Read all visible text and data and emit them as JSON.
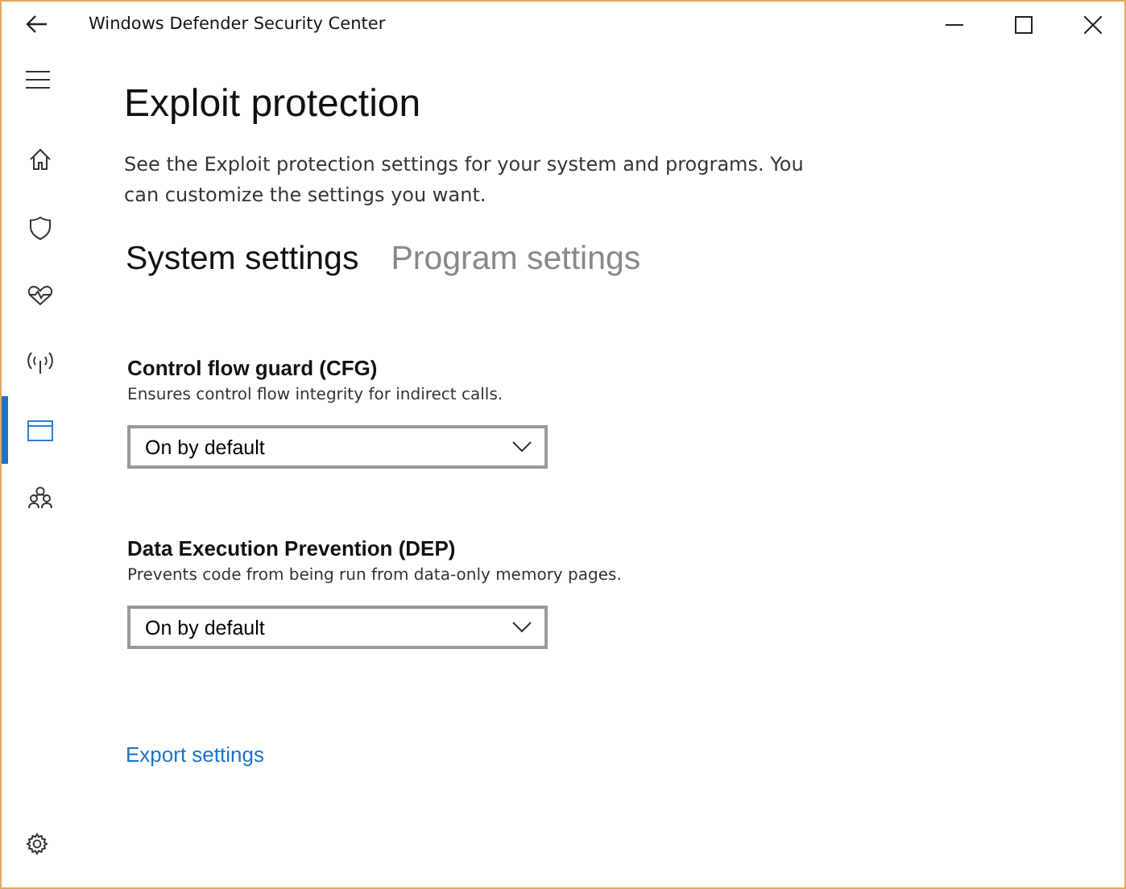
{
  "window": {
    "title": "Windows Defender Security Center"
  },
  "nav": [
    {
      "kind": "home",
      "selected": false
    },
    {
      "kind": "shield",
      "selected": false
    },
    {
      "kind": "heart",
      "selected": false
    },
    {
      "kind": "antenna",
      "selected": false
    },
    {
      "kind": "window",
      "selected": true
    },
    {
      "kind": "family",
      "selected": false
    }
  ],
  "page": {
    "title": "Exploit protection",
    "description": "See the Exploit protection settings for your system and programs.  You can customize the settings you want."
  },
  "tabs": [
    {
      "label": "System settings",
      "selected": true
    },
    {
      "label": "Program settings",
      "selected": false
    }
  ],
  "settings": [
    {
      "title": "Control flow guard (CFG)",
      "description": "Ensures control flow integrity for indirect calls.",
      "value": "On by default"
    },
    {
      "title": "Data Execution Prevention (DEP)",
      "description": "Prevents code from being run from data-only memory pages.",
      "value": "On by default"
    }
  ],
  "link": "Export settings"
}
